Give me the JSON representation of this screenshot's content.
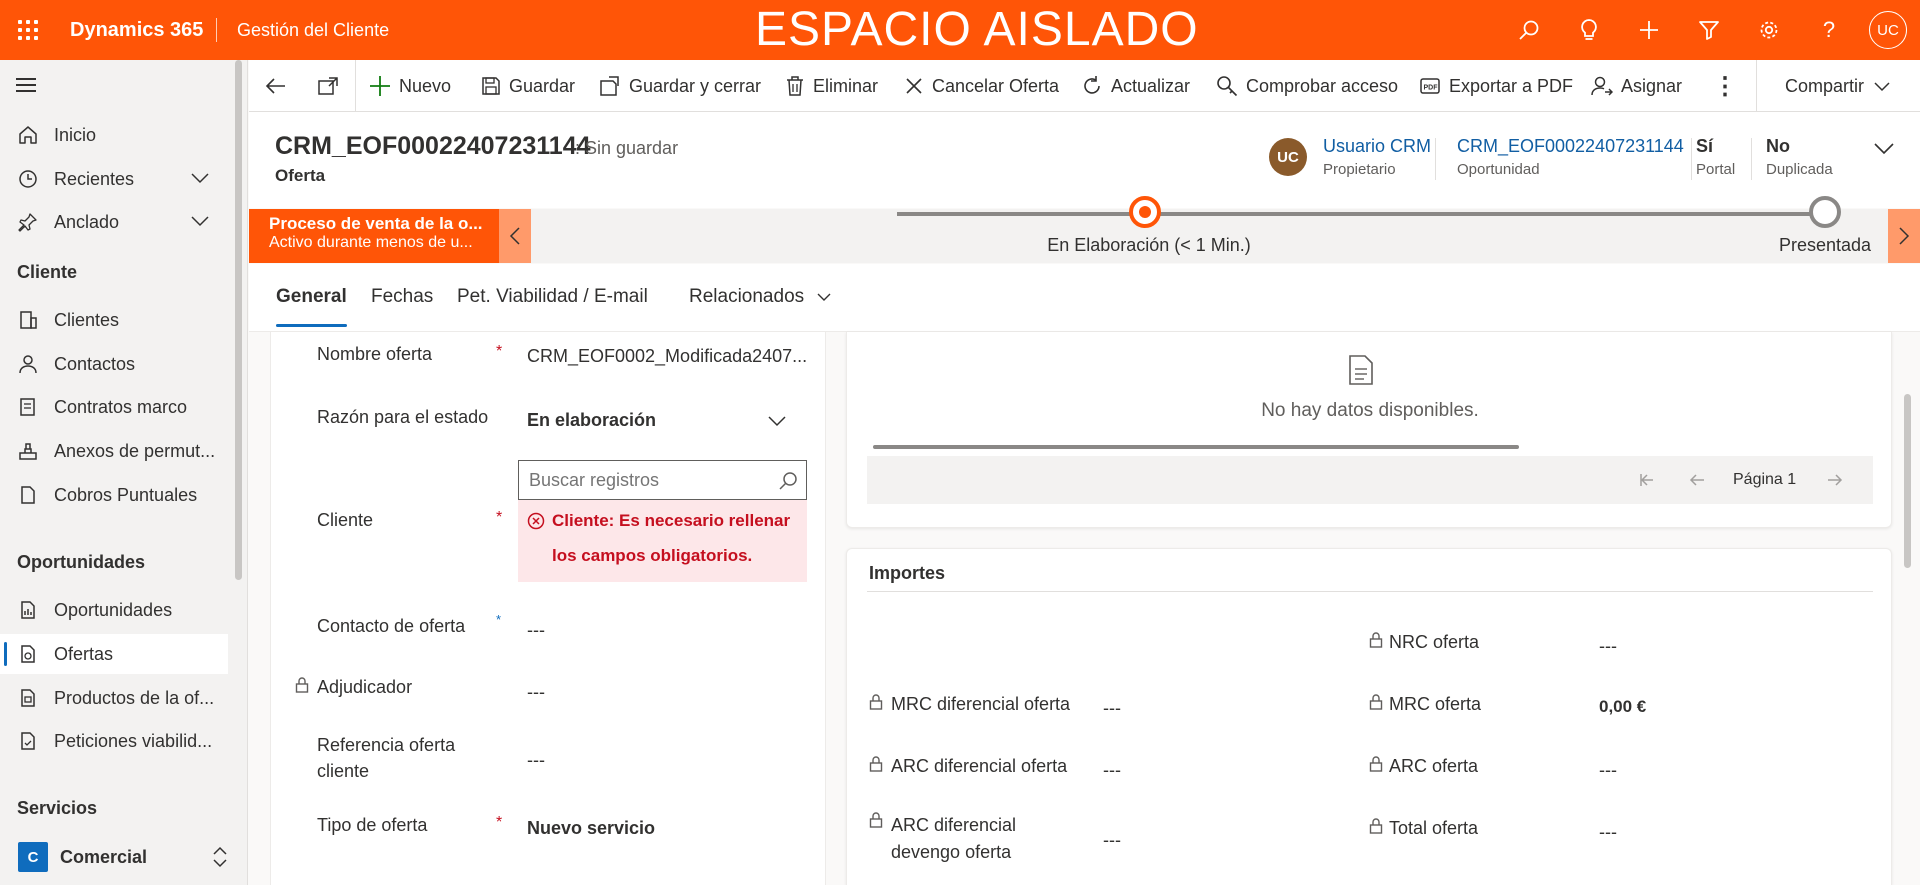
{
  "topbar": {
    "brand": "Dynamics 365",
    "app_name": "Gestión del Cliente",
    "banner": "ESPACIO AISLADO",
    "user_initials": "UC"
  },
  "sidebar": {
    "home": "Inicio",
    "recent": "Recientes",
    "pinned": "Anclado",
    "section_cliente": "Cliente",
    "clientes": "Clientes",
    "contactos": "Contactos",
    "contratos": "Contratos marco",
    "anexos": "Anexos de permut...",
    "cobros": "Cobros Puntuales",
    "section_oportunidades": "Oportunidades",
    "oportunidades": "Oportunidades",
    "ofertas": "Ofertas",
    "productos": "Productos de la of...",
    "peticiones": "Peticiones viabilid...",
    "section_servicios": "Servicios",
    "area_initial": "C",
    "area_name": "Comercial"
  },
  "commands": {
    "nuevo": "Nuevo",
    "guardar": "Guardar",
    "guardar_cerrar": "Guardar y cerrar",
    "eliminar": "Eliminar",
    "cancelar": "Cancelar Oferta",
    "actualizar": "Actualizar",
    "comprobar": "Comprobar acceso",
    "exportar": "Exportar a PDF",
    "asignar": "Asignar",
    "compartir": "Compartir"
  },
  "header": {
    "title": "CRM_EOF00022407231144",
    "unsaved": ": Sin guardar",
    "entity": "Oferta",
    "owner_initials": "UC",
    "owner_name": "Usuario CRM",
    "owner_label": "Propietario",
    "opportunity_value": "CRM_EOF00022407231144",
    "opportunity_label": "Oportunidad",
    "portal_value": "Sí",
    "portal_label": "Portal",
    "duplicada_value": "No",
    "duplicada_label": "Duplicada"
  },
  "bpf": {
    "process_name": "Proceso de venta de la o...",
    "process_status": "Activo durante menos de u...",
    "stage_active": "En Elaboración  (< 1 Min.)",
    "stage_next": "Presentada"
  },
  "tabs": [
    "General",
    "Fechas",
    "Pet. Viabilidad / E-mail",
    "Relacionados"
  ],
  "form": {
    "nombre_label": "Nombre oferta",
    "nombre_value": "CRM_EOF0002_Modificada2407...",
    "razon_label": "Razón para el estado",
    "razon_value": "En elaboración",
    "search_placeholder": "Buscar registros",
    "cliente_label": "Cliente",
    "cliente_error": "Cliente: Es necesario rellenar los campos obligatorios.",
    "contacto_label": "Contacto de oferta",
    "contacto_value": "---",
    "adjudicador_label": "Adjudicador",
    "adjudicador_value": "---",
    "referencia_label": "Referencia oferta cliente",
    "referencia_value": "---",
    "tipo_label": "Tipo de oferta",
    "tipo_value": "Nuevo servicio"
  },
  "grid": {
    "no_data": "No hay datos disponibles.",
    "page_label": "Página 1"
  },
  "importes": {
    "title": "Importes",
    "nrc_label": "NRC oferta",
    "nrc_value": "---",
    "mrc_dif_label": "MRC diferencial oferta",
    "mrc_dif_value": "---",
    "mrc_label": "MRC oferta",
    "mrc_value": "0,00 €",
    "arc_dif_label": "ARC diferencial oferta",
    "arc_dif_value": "---",
    "arc_label": "ARC oferta",
    "arc_value": "---",
    "arc_dev_label": "ARC diferencial devengo oferta",
    "arc_dev_value": "---",
    "total_label": "Total oferta",
    "total_value": "---"
  },
  "colors": {
    "accent": "#ff5507",
    "link": "#115ea3",
    "error": "#c50f1f"
  }
}
